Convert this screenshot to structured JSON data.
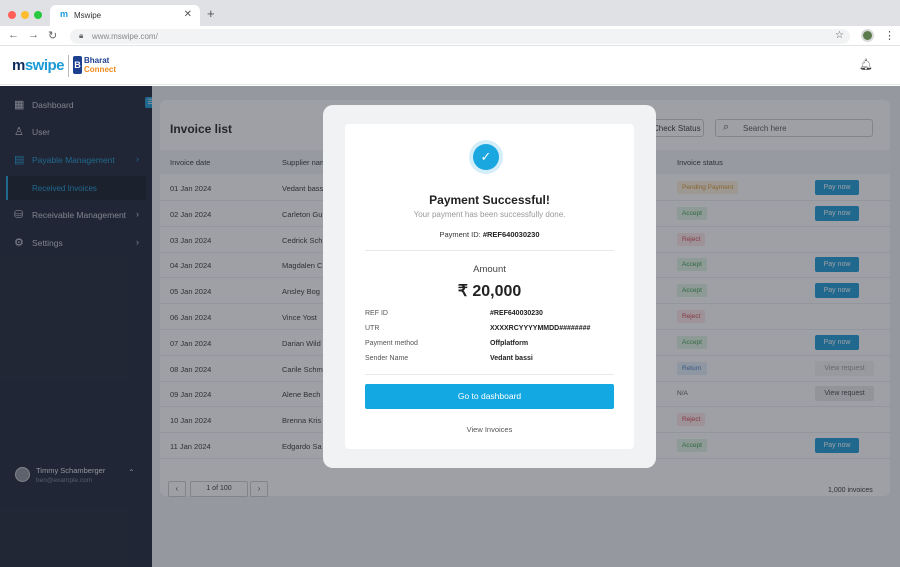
{
  "browser": {
    "tab_title": "Mswipe",
    "tab_favicon": "m",
    "url": "www.mswipe.com/",
    "close_glyph": "✕",
    "new_tab_glyph": "+"
  },
  "header": {
    "logo_text_m": "m",
    "logo_text_rest": "swipe",
    "partner_mark": "B",
    "partner_line1": "Bharat",
    "partner_line2": "Connect",
    "bell_icon": "bell-icon"
  },
  "sidebar": {
    "items": [
      {
        "label": "Dashboard",
        "icon": "dashboard-icon"
      },
      {
        "label": "User",
        "icon": "user-icon"
      },
      {
        "label": "Payable Management",
        "icon": "payable-icon"
      },
      {
        "label": "Receivable Management",
        "icon": "receivable-icon"
      },
      {
        "label": "Settings",
        "icon": "settings-icon"
      }
    ],
    "sub_item": "Received Invoices",
    "user": {
      "name": "Timmy Schamberger",
      "email": "ben@example.com"
    }
  },
  "main": {
    "title": "Invoice list",
    "check_status": "Check Status",
    "search_placeholder": "Search here",
    "columns": [
      "Invoice date",
      "Supplier name",
      "Invoice status"
    ],
    "rows": [
      {
        "date": "01 Jan 2024",
        "supplier": "Vedant bassi",
        "status": "Pending Payment",
        "status_type": "pending",
        "action": "Pay now"
      },
      {
        "date": "02 Jan 2024",
        "supplier": "Carleton Gu",
        "status": "Accept",
        "status_type": "accept",
        "action": "Pay now"
      },
      {
        "date": "03 Jan 2024",
        "supplier": "Cedrick Sch",
        "status": "Reject",
        "status_type": "reject",
        "action": ""
      },
      {
        "date": "04 Jan 2024",
        "supplier": "Magdalen C",
        "status": "Accept",
        "status_type": "accept",
        "action": "Pay now"
      },
      {
        "date": "05 Jan 2024",
        "supplier": "Ansley Bog",
        "status": "Accept",
        "status_type": "accept",
        "action": "Pay now"
      },
      {
        "date": "06 Jan 2024",
        "supplier": "Vince Yost",
        "status": "Reject",
        "status_type": "reject",
        "action": ""
      },
      {
        "date": "07 Jan 2024",
        "supplier": "Darian Wild",
        "status": "Accept",
        "status_type": "accept",
        "action": "Pay now"
      },
      {
        "date": "08 Jan 2024",
        "supplier": "Carile Schm",
        "status": "Return",
        "status_type": "return",
        "action": "View request"
      },
      {
        "date": "09 Jan 2024",
        "supplier": "Alene Bech",
        "status": "N/A",
        "status_type": "na",
        "action": "View request"
      },
      {
        "date": "10 Jan 2024",
        "supplier": "Brenna Kris",
        "status": "Reject",
        "status_type": "reject",
        "action": ""
      },
      {
        "date": "11 Jan 2024",
        "supplier": "Edgardo Sa",
        "status": "Accept",
        "status_type": "accept",
        "action": "Pay now"
      }
    ],
    "pager": {
      "prev": "‹",
      "label": "1 of 100",
      "next": "›"
    },
    "total": "1,000 invoices"
  },
  "modal": {
    "title": "Payment Successful!",
    "subtitle": "Your payment has been successfully done.",
    "payment_id_label": "Payment ID:",
    "payment_id_value": "#REF640030230",
    "amount_label": "Amount",
    "amount_value": "₹ 20,000",
    "details": [
      {
        "key": "REF ID",
        "value": "#REF640030230"
      },
      {
        "key": "UTR",
        "value": "XXXXRCYYYYMMDD########"
      },
      {
        "key": "Payment method",
        "value": "Offplatform"
      },
      {
        "key": "Sender Name",
        "value": "Vedant bassi"
      }
    ],
    "primary_button": "Go to dashboard",
    "link": "View Invoices"
  },
  "colors": {
    "accent": "#1a9ad6",
    "sidebar_bg": "#1b2233",
    "success": "#1aa6df"
  }
}
